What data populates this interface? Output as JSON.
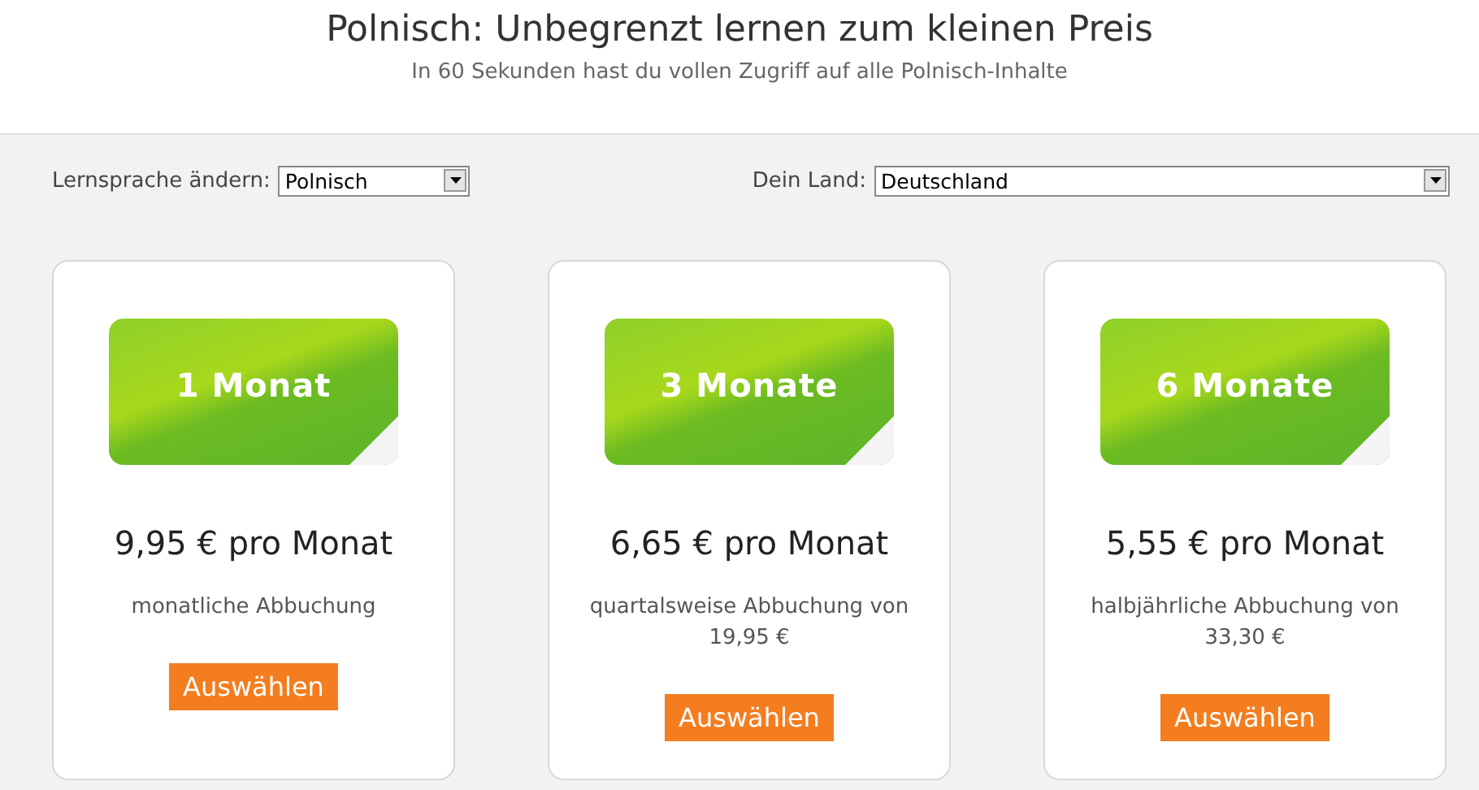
{
  "header": {
    "title": "Polnisch: Unbegrenzt lernen zum kleinen Preis",
    "subtitle": "In 60 Sekunden hast du vollen Zugriff auf alle Polnisch-Inhalte"
  },
  "language_select": {
    "label": "Lernsprache ändern:",
    "value": "Polnisch"
  },
  "country_select": {
    "label": "Dein Land:",
    "value": "Deutschland"
  },
  "plans": [
    {
      "badge": "1 Monat",
      "price": "9,95 € pro Monat",
      "billing": "monatliche Abbuchung",
      "button": "Auswählen"
    },
    {
      "badge": "3 Monate",
      "price": "6,65 € pro Monat",
      "billing": "quartalsweise Abbuchung von 19,95 €",
      "button": "Auswählen"
    },
    {
      "badge": "6 Monate",
      "price": "5,55 € pro Monat",
      "billing": "halbjährliche Abbuchung von 33,30 €",
      "button": "Auswählen"
    }
  ]
}
